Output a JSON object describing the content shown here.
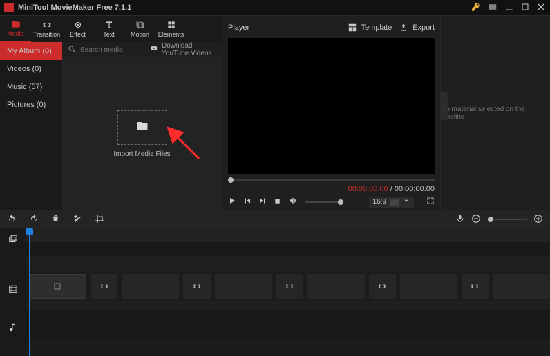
{
  "app": {
    "title": "MiniTool MovieMaker Free 7.1.1"
  },
  "tabs": {
    "media": "Media",
    "transition": "Transition",
    "effect": "Effect",
    "text": "Text",
    "motion": "Motion",
    "elements": "Elements"
  },
  "sidebar": {
    "items": [
      {
        "label": "My Album (0)"
      },
      {
        "label": "Videos (0)"
      },
      {
        "label": "Music (57)"
      },
      {
        "label": "Pictures (0)"
      }
    ]
  },
  "media_stage": {
    "search_placeholder": "Search media",
    "youtube_label": "Download YouTube Videos",
    "import_label": "Import Media Files"
  },
  "player": {
    "title": "Player",
    "template_label": "Template",
    "export_label": "Export",
    "time_current": "00:00:00.00",
    "time_separator": " / ",
    "time_total": "00:00:00.00",
    "aspect": "16:9"
  },
  "inspector": {
    "empty": "No material selected on the timeline"
  }
}
